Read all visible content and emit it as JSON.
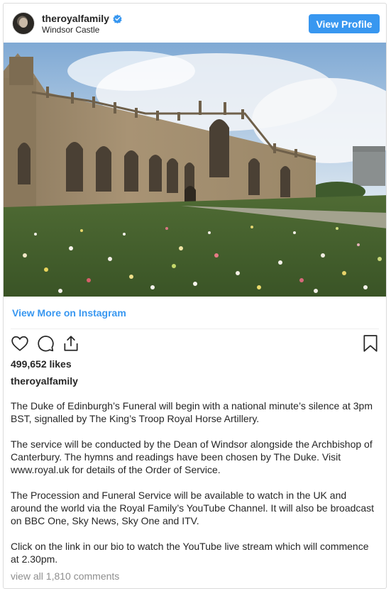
{
  "header": {
    "username": "theroyalfamily",
    "location": "Windsor Castle",
    "view_profile_label": "View Profile"
  },
  "post": {
    "image_alt": "Windsor Castle",
    "view_more_label": "View More on Instagram",
    "likes": "499,652 likes",
    "caption_username": "theroyalfamily",
    "caption_paragraphs": [
      "The Duke of Edinburgh’s Funeral will begin with a national minute’s silence at 3pm BST, signalled by The King’s Troop Royal Horse Artillery.",
      "The service will be conducted by the Dean of Windsor alongside the Archbishop of Canterbury. The hymns and readings have been chosen by The Duke. Visit www.royal.uk for details of the Order of Service.",
      "The Procession and Funeral Service will be available to watch in the UK and around the world via the Royal Family’s YouTube Channel. It will also be broadcast on BBC One, Sky News, Sky One and ITV.",
      "Click on the link in our bio to watch the YouTube live stream which will commence at 2.30pm."
    ],
    "comments_link": "view all 1,810 comments"
  },
  "icons": {
    "avatar": "profile-avatar",
    "verified": "verified-badge-icon",
    "like": "heart-icon",
    "comment": "comment-bubble-icon",
    "share": "share-icon",
    "save": "bookmark-icon"
  },
  "colors": {
    "accent": "#3897f0",
    "text": "#262626",
    "muted": "#8e8e8e"
  }
}
